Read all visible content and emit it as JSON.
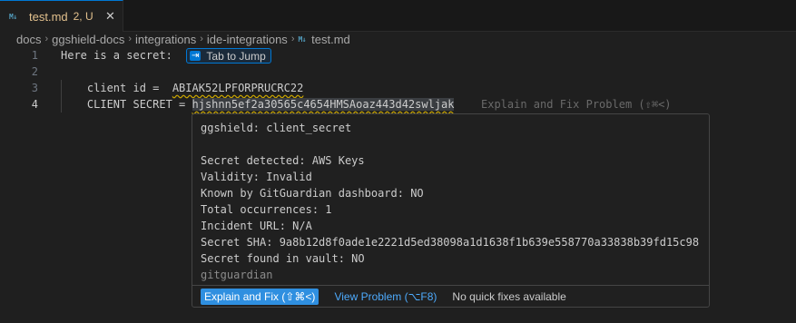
{
  "tab": {
    "icon": "M↓",
    "name": "test.md",
    "badge": "2, U",
    "close": "✕"
  },
  "breadcrumb": {
    "items": [
      "docs",
      "ggshield-docs",
      "integrations",
      "ide-integrations"
    ],
    "file_icon": "M↓",
    "file": "test.md",
    "separator": "›"
  },
  "editor": {
    "lines": [
      {
        "number": "1",
        "text": "Here is a secret:"
      },
      {
        "number": "2",
        "text": ""
      },
      {
        "number": "3",
        "text_prefix": "    client id =  ",
        "text_secret": "ABIAK52LPFORPRUCRC22"
      },
      {
        "number": "4",
        "text_prefix": "    CLIENT SECRET = ",
        "text_secret": "hjshnn5ef2a30565c4654HMSAoaz443d42swljak"
      }
    ],
    "jump_icon": "⇥",
    "jump_label": "Tab to Jump",
    "ghost_text": "Explain and Fix Problem (⇧⌘<)"
  },
  "hover": {
    "lines": [
      "ggshield: client_secret",
      "",
      "Secret detected: AWS Keys",
      "Validity: Invalid",
      "Known by GitGuardian dashboard: NO",
      "Total occurrences: 1",
      "Incident URL: N/A",
      "Secret SHA: 9a8b12d8f0ade1e2221d5ed38098a1d1638f1b639e558770a33838b39fd15c98",
      "Secret found in vault: NO"
    ],
    "source": "gitguardian",
    "actions": {
      "explain_fix": "Explain and Fix (⇧⌘<)",
      "view_problem": "View Problem (⌥F8)",
      "no_fixes": "No quick fixes available"
    }
  },
  "colors": {
    "accent": "#0078d4",
    "modified_tab": "#e2c08d",
    "warning_squiggle": "#cca700",
    "link": "#4daafc"
  }
}
